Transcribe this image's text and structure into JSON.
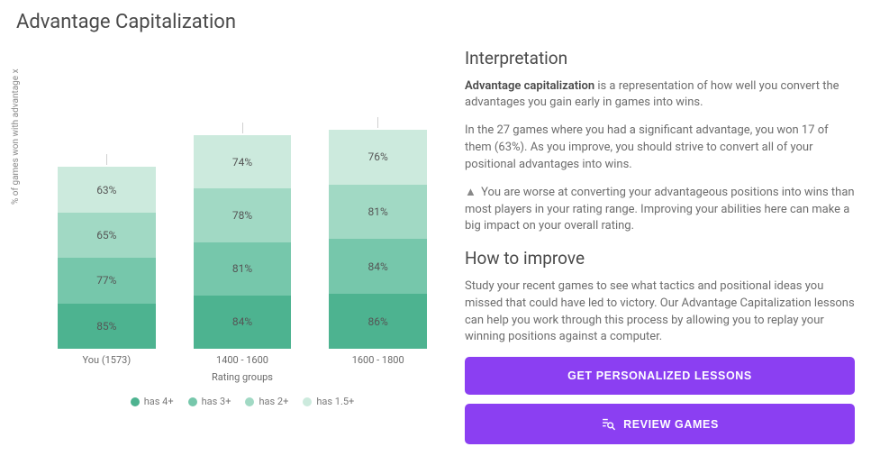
{
  "title": "Advantage Capitalization",
  "chart_data": {
    "type": "bar",
    "stacked_display": true,
    "ylabel": "% of games won with advantage x",
    "xlabel": "Rating groups",
    "ylim": [
      0,
      100
    ],
    "categories": [
      "You (1573)",
      "1400 - 1600",
      "1600 - 1800"
    ],
    "series": [
      {
        "name": "has 4+",
        "color": "#4db390",
        "values": [
          85,
          84,
          86
        ]
      },
      {
        "name": "has 3+",
        "color": "#76c7ab",
        "values": [
          77,
          81,
          84
        ]
      },
      {
        "name": "has 2+",
        "color": "#a1d9c4",
        "values": [
          65,
          78,
          81
        ]
      },
      {
        "name": "has 1.5+",
        "color": "#cceadd",
        "values": [
          63,
          74,
          76
        ]
      }
    ]
  },
  "interpretation": {
    "heading": "Interpretation",
    "lead_strong": "Advantage capitalization",
    "lead_rest": " is a representation of how well you convert the advantages you gain early in games into wins.",
    "p2": "In the 27 games where you had a significant advantage, you won 17 of them (63%). As you improve, you should strive to convert all of your positional advantages into wins.",
    "warn": "You are worse at converting your advantageous positions into wins than most players in your rating range. Improving your abilities here can make a big impact on your overall rating."
  },
  "improve": {
    "heading": "How to improve",
    "p1": "Study your recent games to see what tactics and positional ideas you missed that could have led to victory. Our Advantage Capitalization lessons can help you work through this process by allowing you to replay your winning positions against a computer."
  },
  "buttons": {
    "lessons": "GET PERSONALIZED LESSONS",
    "review": "REVIEW GAMES"
  }
}
